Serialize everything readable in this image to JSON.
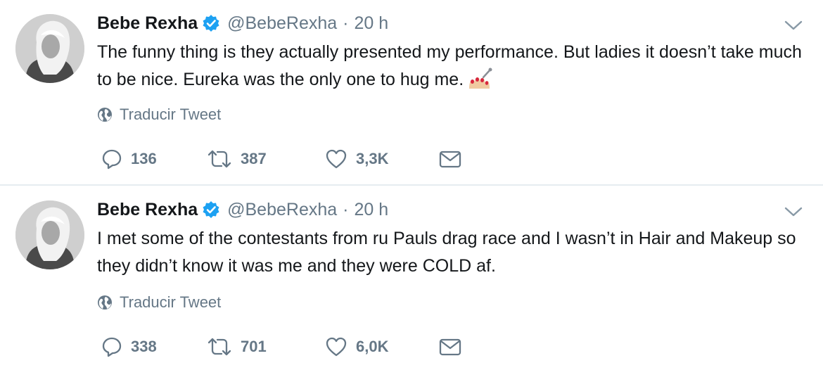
{
  "tweets": [
    {
      "name": "Bebe Rexha",
      "handle": "@BebeRexha",
      "separator": "·",
      "time": "20 h",
      "text": "The funny thing is they actually presented my performance. But ladies it doesn’t take much to be nice. Eureka was the only one to hug me.",
      "emoji": "nail-polish-emoji",
      "translate_label": "Traducir Tweet",
      "replies": "136",
      "retweets": "387",
      "likes": "3,3K"
    },
    {
      "name": "Bebe Rexha",
      "handle": "@BebeRexha",
      "separator": "·",
      "time": "20 h",
      "text": "I met some of the contestants from ru Pauls drag race and I wasn’t in Hair and Makeup so they didn’t know it was me and they were COLD af.",
      "translate_label": "Traducir Tweet",
      "replies": "338",
      "retweets": "701",
      "likes": "6,0K"
    }
  ],
  "colors": {
    "text": "#14171a",
    "secondary": "#657786",
    "verified": "#1da1f2",
    "divider": "#e6ecf0"
  },
  "icons": [
    "verified-badge-icon",
    "chevron-down-icon",
    "globe-icon",
    "reply-icon",
    "retweet-icon",
    "heart-icon",
    "direct-message-icon"
  ]
}
